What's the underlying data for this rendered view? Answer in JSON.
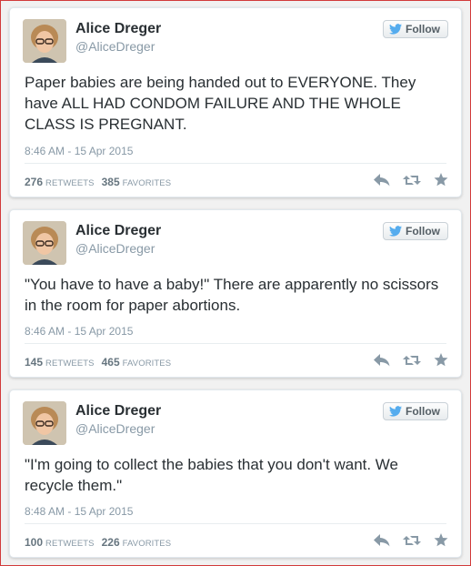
{
  "follow_label": "Follow",
  "tweets": [
    {
      "name": "Alice Dreger",
      "handle": "@AliceDreger",
      "text": "Paper babies are being handed out to EVERYONE. They have ALL HAD CONDOM FAILURE AND THE WHOLE CLASS IS PREGNANT.",
      "time": "8:46 AM - 15 Apr 2015",
      "retweets": "276",
      "retweets_label": "RETWEETS",
      "favorites": "385",
      "favorites_label": "FAVORITES"
    },
    {
      "name": "Alice Dreger",
      "handle": "@AliceDreger",
      "text": "\"You have to have a baby!\" There are apparently no scissors in the room for paper abortions.",
      "time": "8:46 AM - 15 Apr 2015",
      "retweets": "145",
      "retweets_label": "RETWEETS",
      "favorites": "465",
      "favorites_label": "FAVORITES"
    },
    {
      "name": "Alice Dreger",
      "handle": "@AliceDreger",
      "text": "\"I'm going to collect the babies that you don't want. We recycle them.\"",
      "time": "8:48 AM - 15 Apr 2015",
      "retweets": "100",
      "retweets_label": "RETWEETS",
      "favorites": "226",
      "favorites_label": "FAVORITES"
    }
  ],
  "icons": {
    "bird": "twitter-bird-icon",
    "reply": "reply-icon",
    "retweet": "retweet-icon",
    "favorite": "star-icon"
  },
  "colors": {
    "bird_blue": "#55acee",
    "muted": "#8899a6",
    "text": "#292f33",
    "frame_border": "#d23a3a"
  }
}
